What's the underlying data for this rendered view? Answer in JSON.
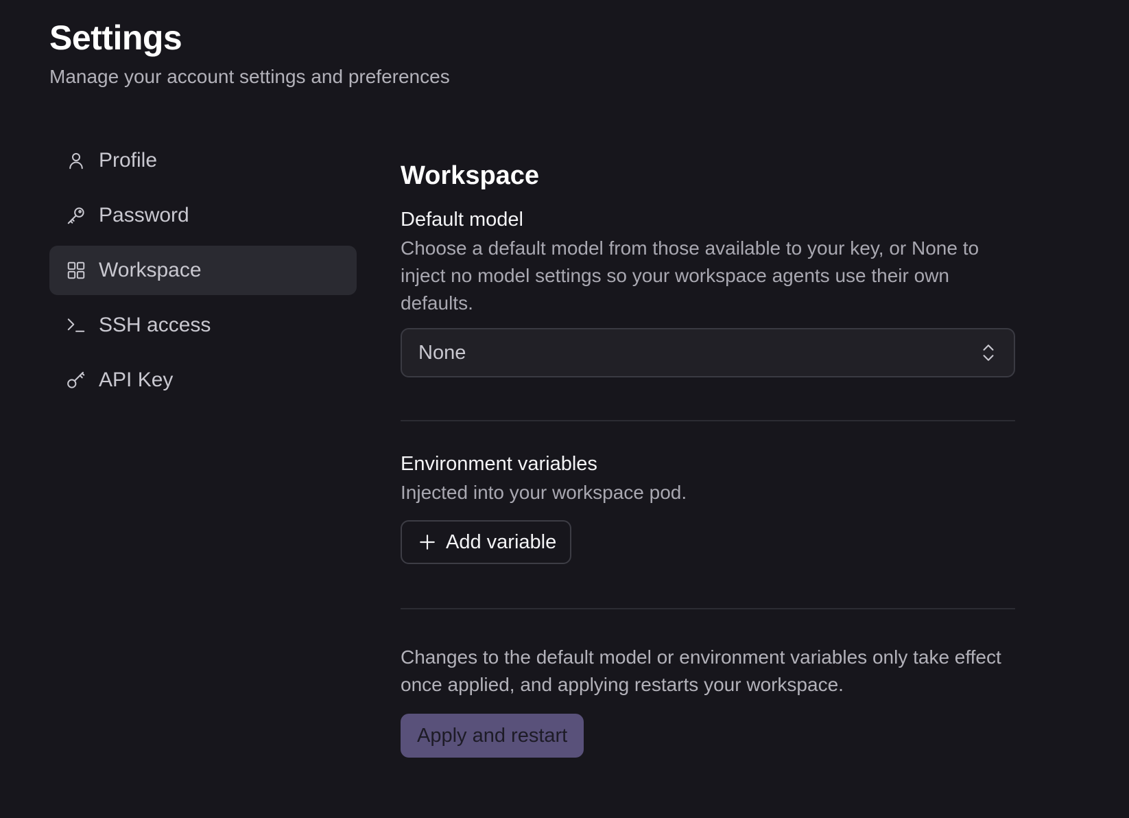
{
  "header": {
    "title": "Settings",
    "subtitle": "Manage your account settings and preferences"
  },
  "sidebar": {
    "items": [
      {
        "label": "Profile",
        "icon": "user-icon",
        "active": false
      },
      {
        "label": "Password",
        "icon": "key-icon",
        "active": false
      },
      {
        "label": "Workspace",
        "icon": "grid-icon",
        "active": true
      },
      {
        "label": "SSH access",
        "icon": "terminal-icon",
        "active": false
      },
      {
        "label": "API Key",
        "icon": "api-key-icon",
        "active": false
      }
    ]
  },
  "main": {
    "section_title": "Workspace",
    "default_model": {
      "label": "Default model",
      "description": "Choose a default model from those available to your key, or None to inject no model settings so your workspace agents use their own defaults.",
      "selected": "None"
    },
    "env_vars": {
      "label": "Environment variables",
      "description": "Injected into your workspace pod.",
      "add_button": "Add variable"
    },
    "note": "Changes to the default model or environment variables only take effect once applied, and applying restarts your workspace.",
    "apply_button": "Apply and restart"
  },
  "colors": {
    "background": "#17161c",
    "active_nav": "#2a2a31",
    "apply_button": "#59517a"
  }
}
